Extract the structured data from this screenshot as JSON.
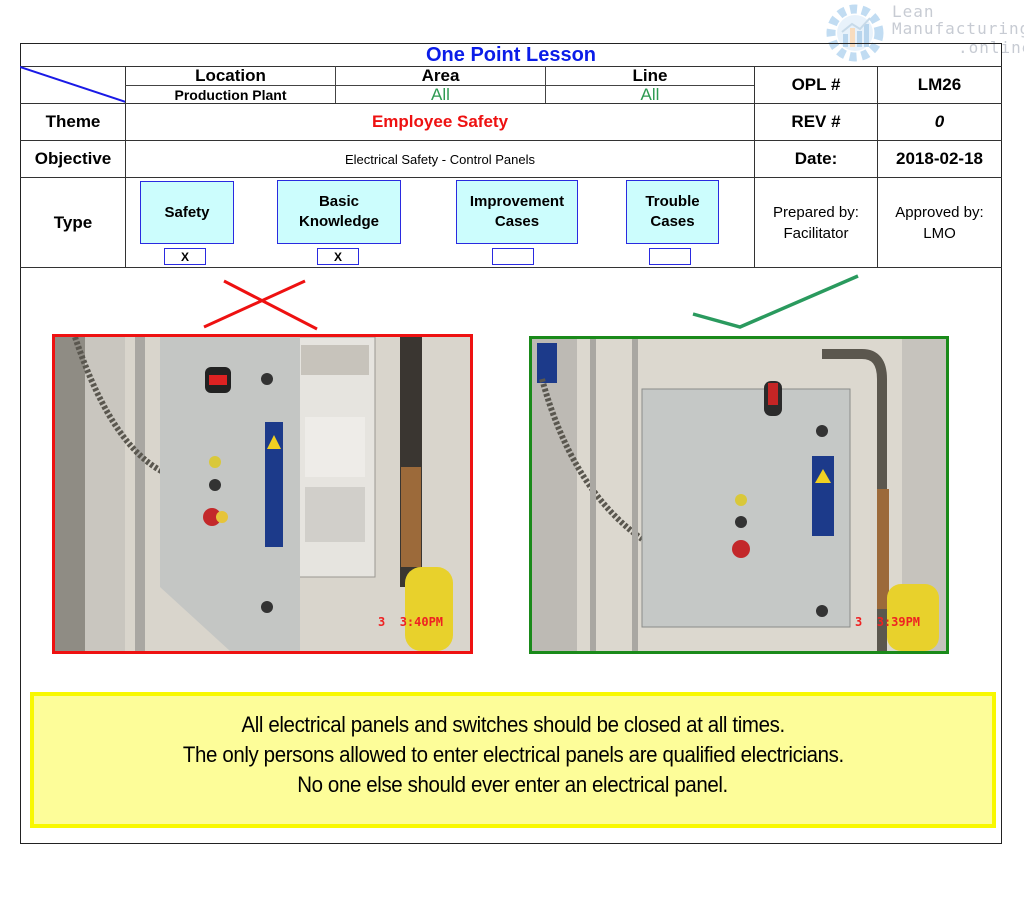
{
  "watermark": {
    "line1": "Lean",
    "line2": "Manufacturing",
    "line3": ".online"
  },
  "header": {
    "title": "One Point Lesson",
    "location_label": "Location",
    "location_value": "Production Plant",
    "area_label": "Area",
    "area_value": "All",
    "line_label": "Line",
    "line_value": "All",
    "opl_label": "OPL #",
    "opl_value": "LM26"
  },
  "theme": {
    "label": "Theme",
    "value": "Employee Safety",
    "rev_label": "REV #",
    "rev_value": "0"
  },
  "objective": {
    "label": "Objective",
    "value": "Electrical Safety - Control Panels",
    "date_label": "Date:",
    "date_value": "2018-02-18"
  },
  "type": {
    "label": "Type",
    "options": [
      {
        "line1": "Safety",
        "line2": "",
        "checked": "X"
      },
      {
        "line1": "Basic",
        "line2": "Knowledge",
        "checked": "X"
      },
      {
        "line1": "Improvement",
        "line2": "Cases",
        "checked": ""
      },
      {
        "line1": "Trouble",
        "line2": "Cases",
        "checked": ""
      }
    ],
    "prepared_label": "Prepared by:",
    "prepared_value": "Facilitator",
    "approved_label": "Approved by:",
    "approved_value": "LMO"
  },
  "photos": {
    "bad": {
      "mark": "wrong",
      "timestamp_day": "3",
      "timestamp_time": "3:40PM",
      "frame_color": "#ee1111"
    },
    "good": {
      "mark": "correct",
      "timestamp_day": "3",
      "timestamp_time": "3:39PM",
      "frame_color": "#1a8a1a"
    }
  },
  "notes": [
    "All electrical panels and switches should be closed at all times.",
    "The only persons allowed to enter electrical panels are qualified electricians.",
    "No one else should ever enter an electrical panel."
  ]
}
